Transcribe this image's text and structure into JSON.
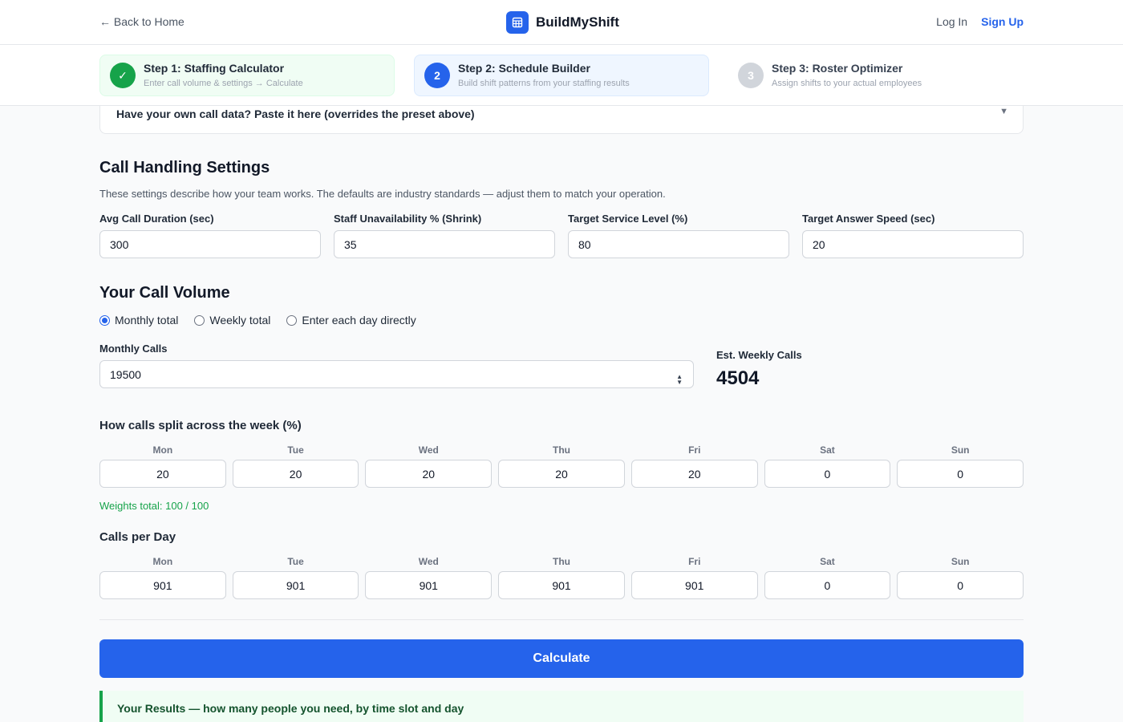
{
  "header": {
    "back_label": "← Back to Home",
    "brand_name": "BuildMyShift",
    "login_label": "Log In",
    "signup_label": "Sign Up"
  },
  "steps": [
    {
      "badge": "✓",
      "title": "Step 1: Staffing Calculator",
      "subtitle": "Enter call volume & settings → Calculate",
      "status": "complete"
    },
    {
      "badge": "2",
      "title": "Step 2: Schedule Builder",
      "subtitle": "Build shift patterns from your staffing results",
      "status": "active"
    },
    {
      "badge": "3",
      "title": "Step 3: Roster Optimizer",
      "subtitle": "Assign shifts to your actual employees",
      "status": "pending"
    }
  ],
  "paste": {
    "label": "Have your own call data? Paste it here (overrides the preset above)",
    "chevron": "▼"
  },
  "settings": {
    "title": "Call Handling Settings",
    "description": "These settings describe how your team works. The defaults are industry standards — adjust them to match your operation.",
    "fields": [
      {
        "label": "Avg Call Duration (sec)",
        "value": "300"
      },
      {
        "label": "Staff Unavailability % (Shrink)",
        "value": "35"
      },
      {
        "label": "Target Service Level (%)",
        "value": "80"
      },
      {
        "label": "Target Answer Speed (sec)",
        "value": "20"
      }
    ]
  },
  "volume": {
    "title": "Your Call Volume",
    "modes": [
      {
        "label": "Monthly total",
        "checked": true
      },
      {
        "label": "Weekly total",
        "checked": false
      },
      {
        "label": "Enter each day directly",
        "checked": false
      }
    ],
    "monthly_label": "Monthly Calls",
    "monthly_value": "19500",
    "est_label": "Est. Weekly Calls",
    "est_value": "4504"
  },
  "split": {
    "title": "How calls split across the week (%)",
    "days": [
      "Mon",
      "Tue",
      "Wed",
      "Thu",
      "Fri",
      "Sat",
      "Sun"
    ],
    "values": [
      "20",
      "20",
      "20",
      "20",
      "20",
      "0",
      "0"
    ],
    "total_text": "Weights total: 100 / 100"
  },
  "per_day": {
    "title": "Calls per Day",
    "days": [
      "Mon",
      "Tue",
      "Wed",
      "Thu",
      "Fri",
      "Sat",
      "Sun"
    ],
    "values": [
      "901",
      "901",
      "901",
      "901",
      "901",
      "0",
      "0"
    ]
  },
  "calculate_label": "Calculate",
  "results_label": "Your Results — how many people you need, by time slot and day",
  "colors": {
    "accent": "#2563eb",
    "success": "#16a34a"
  }
}
